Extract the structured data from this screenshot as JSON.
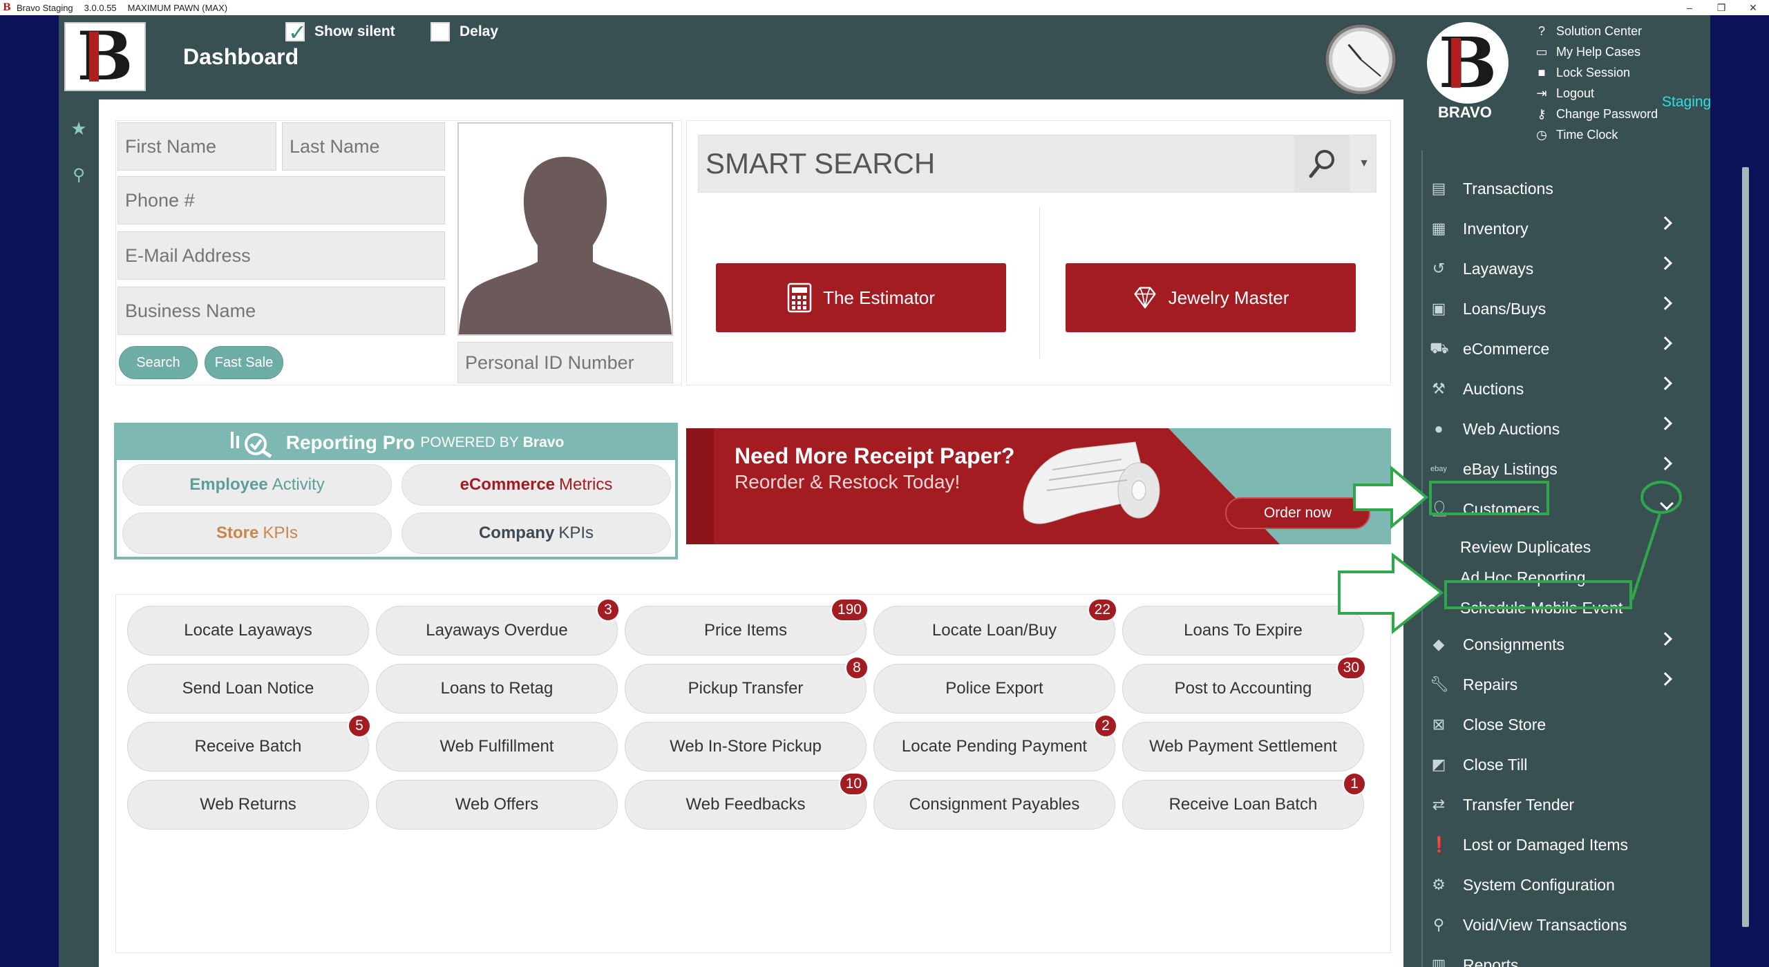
{
  "window": {
    "app_name": "Bravo Staging",
    "version": "3.0.0.55",
    "store": "MAXIMUM PAWN (MAX)",
    "min": "–",
    "restore": "❐",
    "close": "✕"
  },
  "header": {
    "title": "Dashboard",
    "show_silent_label": "Show silent",
    "delay_label": "Delay",
    "brand": "BRAVO",
    "staging_label": "Staging"
  },
  "help_links": [
    {
      "label": "Solution Center",
      "icon": "question-circle-icon"
    },
    {
      "label": "My Help Cases",
      "icon": "folder-icon"
    },
    {
      "label": "Lock Session",
      "icon": "lock-icon"
    },
    {
      "label": "Logout",
      "icon": "logout-icon"
    },
    {
      "label": "Change Password",
      "icon": "key-icon"
    },
    {
      "label": "Time Clock",
      "icon": "clock-icon"
    }
  ],
  "customer_form": {
    "first_name_ph": "First Name",
    "last_name_ph": "Last Name",
    "phone_ph": "Phone #",
    "email_ph": "E-Mail Address",
    "business_ph": "Business Name",
    "personal_id_ph": "Personal ID Number",
    "search_btn": "Search",
    "fast_sale_btn": "Fast Sale"
  },
  "smart_search": {
    "placeholder": "SMART SEARCH",
    "estimator_btn": "The Estimator",
    "jewelry_btn": "Jewelry Master"
  },
  "reporting": {
    "title": "Reporting Pro",
    "powered": "POWERED BY",
    "brand": "Bravo",
    "employee_1": "Employee",
    "employee_2": "Activity",
    "ecommerce_1": "eCommerce",
    "ecommerce_2": "Metrics",
    "store_1": "Store",
    "store_2": "KPIs",
    "company_1": "Company",
    "company_2": "KPIs",
    "colors": {
      "employee": "#5b9f98",
      "ecommerce": "#a31c22",
      "store": "#c8874a",
      "company": "#3b4a55"
    }
  },
  "banner": {
    "line1": "Need More Receipt Paper?",
    "line2": "Reorder & Restock Today!",
    "order_btn": "Order now"
  },
  "actions": [
    {
      "label": "Locate Layaways",
      "badge": ""
    },
    {
      "label": "Layaways Overdue",
      "badge": "3"
    },
    {
      "label": "Price Items",
      "badge": "190"
    },
    {
      "label": "Locate Loan/Buy",
      "badge": "22"
    },
    {
      "label": "Loans To Expire",
      "badge": ""
    },
    {
      "label": "Send Loan Notice",
      "badge": ""
    },
    {
      "label": "Loans to Retag",
      "badge": ""
    },
    {
      "label": "Pickup Transfer",
      "badge": "8"
    },
    {
      "label": "Police Export",
      "badge": ""
    },
    {
      "label": "Post to Accounting",
      "badge": "30"
    },
    {
      "label": "Receive Batch",
      "badge": "5"
    },
    {
      "label": "Web Fulfillment",
      "badge": ""
    },
    {
      "label": "Web In-Store Pickup",
      "badge": ""
    },
    {
      "label": "Locate Pending Payment",
      "badge": "2"
    },
    {
      "label": "Web Payment Settlement",
      "badge": ""
    },
    {
      "label": "Web Returns",
      "badge": ""
    },
    {
      "label": "Web Offers",
      "badge": ""
    },
    {
      "label": "Web Feedbacks",
      "badge": "10"
    },
    {
      "label": "Consignment Payables",
      "badge": ""
    },
    {
      "label": "Receive Loan Batch",
      "badge": "1"
    }
  ],
  "nav": {
    "items": [
      {
        "label": "Transactions",
        "icon": "transactions-icon",
        "chevron": false
      },
      {
        "label": "Inventory",
        "icon": "inventory-icon",
        "chevron": true
      },
      {
        "label": "Layaways",
        "icon": "layaways-icon",
        "chevron": true
      },
      {
        "label": "Loans/Buys",
        "icon": "loans-icon",
        "chevron": true
      },
      {
        "label": "eCommerce",
        "icon": "cart-icon",
        "chevron": true
      },
      {
        "label": "Auctions",
        "icon": "gavel-icon",
        "chevron": true
      },
      {
        "label": "Web Auctions",
        "icon": "mouse-icon",
        "chevron": true
      },
      {
        "label": "eBay Listings",
        "icon": "ebay-icon",
        "chevron": true
      },
      {
        "label": "Customers",
        "icon": "user-icon",
        "chevron": false
      },
      {
        "label": "Consignments",
        "icon": "tag-icon",
        "chevron": true
      },
      {
        "label": "Repairs",
        "icon": "wrench-icon",
        "chevron": true
      },
      {
        "label": "Close Store",
        "icon": "close-store-icon",
        "chevron": false
      },
      {
        "label": "Close Till",
        "icon": "close-till-icon",
        "chevron": false
      },
      {
        "label": "Transfer Tender",
        "icon": "transfer-icon",
        "chevron": false
      },
      {
        "label": "Lost or Damaged Items",
        "icon": "alert-icon",
        "chevron": false
      },
      {
        "label": "System Configuration",
        "icon": "gears-icon",
        "chevron": false
      },
      {
        "label": "Void/View Transactions",
        "icon": "search-icon",
        "chevron": false
      },
      {
        "label": "Reports",
        "icon": "report-icon",
        "chevron": false
      }
    ],
    "ebay_text": "ebay",
    "sub_items": [
      "Review Duplicates",
      "Ad Hoc Reporting",
      "Schedule Mobile Event"
    ]
  }
}
